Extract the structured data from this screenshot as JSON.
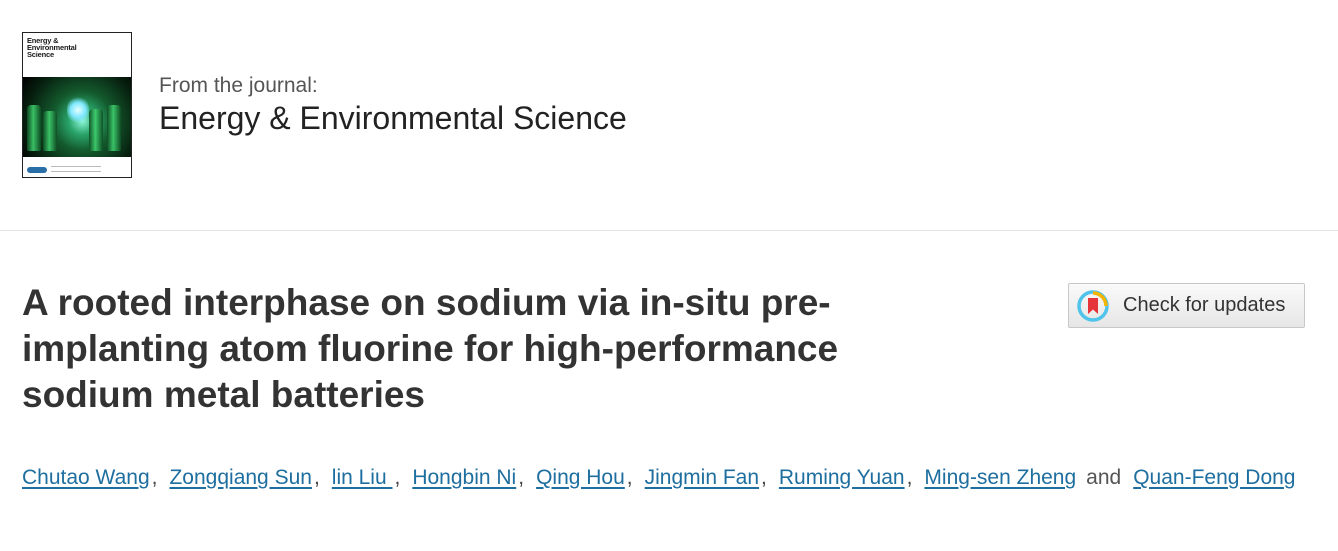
{
  "journal": {
    "cover_title_line1": "Energy &",
    "cover_title_line2": "Environmental",
    "cover_title_line3": "Science",
    "from_label": "From the journal:",
    "name": "Energy & Environmental Science"
  },
  "article": {
    "title": "A rooted interphase on sodium via in-situ pre-implanting atom fluorine for high-performance sodium metal batteries"
  },
  "check_updates": {
    "label": "Check for updates"
  },
  "authors": {
    "list": [
      "Chutao Wang",
      "Zongqiang Sun",
      "lin Liu ",
      "Hongbin Ni",
      "Qing Hou",
      "Jingmin Fan",
      "Ruming Yuan",
      "Ming-sen Zheng",
      "Quan-Feng Dong"
    ],
    "separator": ",",
    "conjunction": "and"
  },
  "colors": {
    "link": "#1e6e9f",
    "title": "#333333",
    "badge_ring": "#4fc3ea",
    "badge_mark": "#e5343a",
    "badge_accent": "#f4b400"
  }
}
